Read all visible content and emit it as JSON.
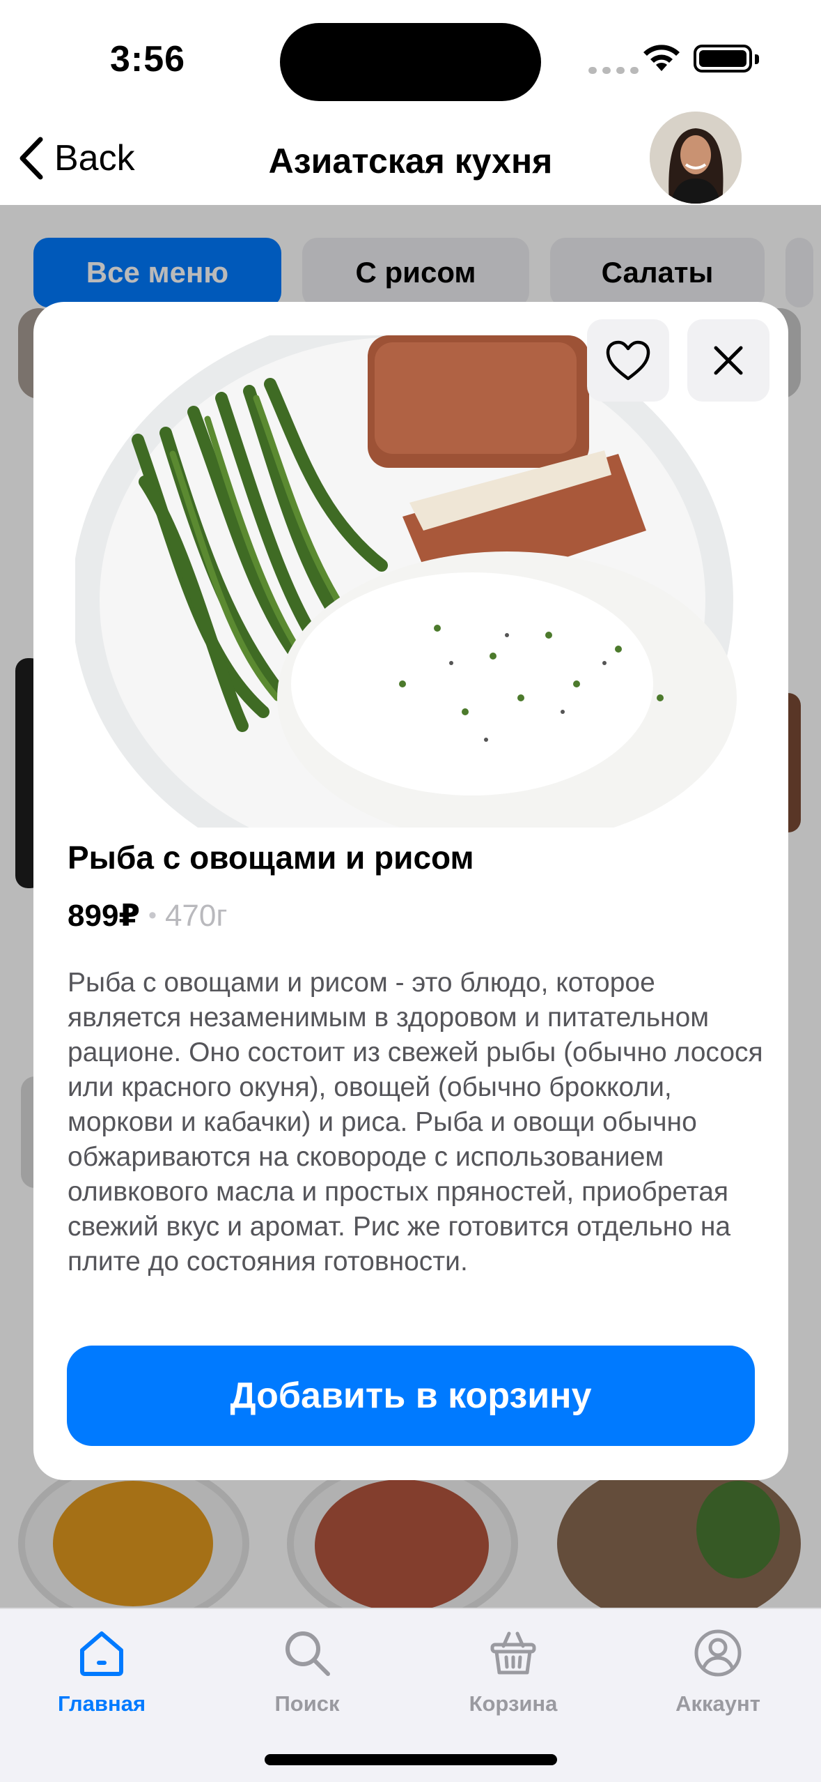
{
  "status_bar": {
    "time": "3:56"
  },
  "nav": {
    "back_label": "Back",
    "title": "Азиатская кухня"
  },
  "categories": [
    {
      "label": "Все меню",
      "active": true
    },
    {
      "label": "С рисом",
      "active": false
    },
    {
      "label": "Салаты",
      "active": false
    }
  ],
  "modal": {
    "dish_name": "Рыба с овощами и рисом",
    "price": "899₽",
    "separator": "•",
    "weight": "470г",
    "description": "Рыба с овощами и рисом - это блюдо, которое является незаменимым в здоровом и питательном рационе. Оно состоит из свежей рыбы (обычно лосося или красного окуня), овощей (обычно брокколи, моркови и кабачки) и риса. Рыба и овощи обычно обжариваются на сковороде с использованием оливкового масла и простых пряностей, приобретая свежий вкус и аромат. Рис же готовится отдельно на плите до состояния готовности.",
    "add_to_cart_label": "Добавить в корзину",
    "fav_icon": "heart-icon",
    "close_icon": "close-icon"
  },
  "tab_bar": {
    "items": [
      {
        "label": "Главная",
        "icon": "home-icon",
        "active": true
      },
      {
        "label": "Поиск",
        "icon": "search-icon",
        "active": false
      },
      {
        "label": "Корзина",
        "icon": "basket-icon",
        "active": false
      },
      {
        "label": "Аккаунт",
        "icon": "account-icon",
        "active": false
      }
    ]
  },
  "colors": {
    "accent": "#007aff",
    "inactive": "#9a9aa0",
    "tabbar_bg": "#f2f2f7"
  }
}
